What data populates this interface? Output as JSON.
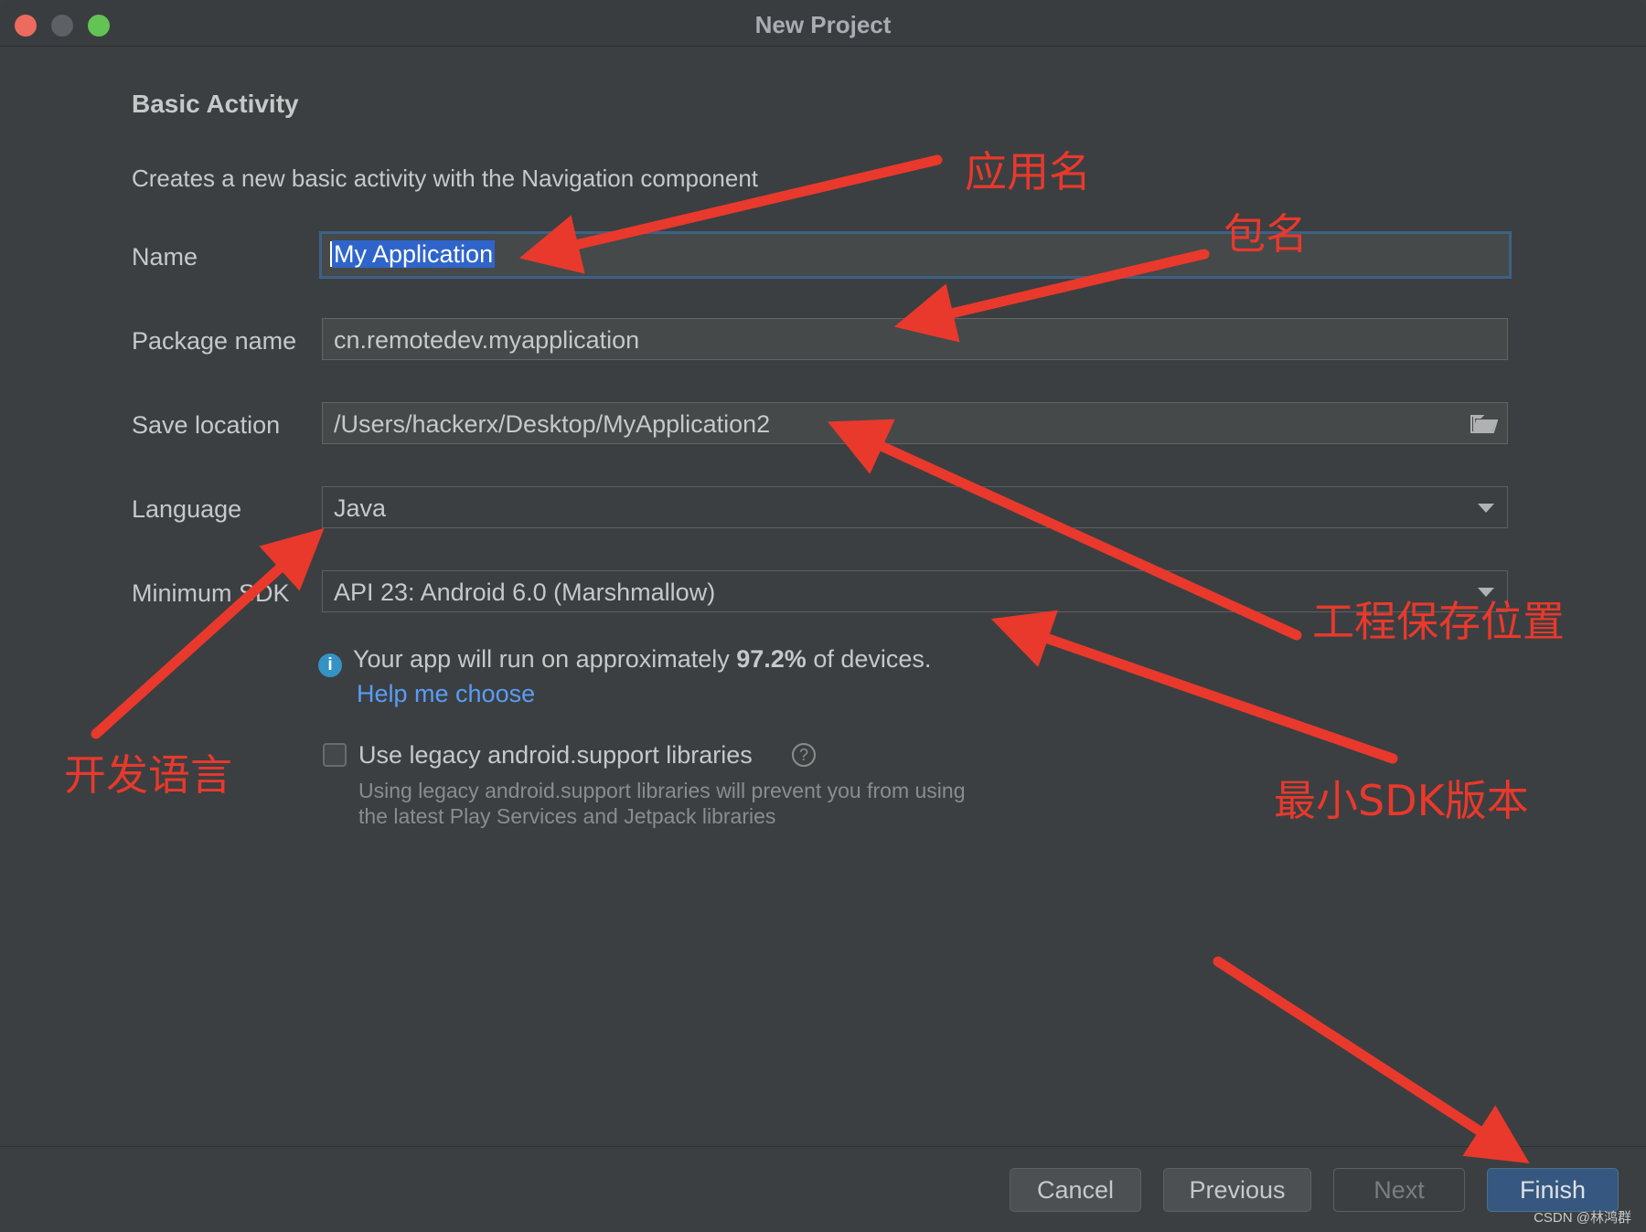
{
  "window": {
    "title": "New Project"
  },
  "heading": "Basic Activity",
  "description": "Creates a new basic activity with the Navigation component",
  "form": {
    "name_label": "Name",
    "name_value": "My Application",
    "package_label": "Package name",
    "package_value": "cn.remotedev.myapplication",
    "save_label": "Save location",
    "save_value": "/Users/hackerx/Desktop/MyApplication2",
    "language_label": "Language",
    "language_value": "Java",
    "sdk_label": "Minimum SDK",
    "sdk_value": "API 23: Android 6.0 (Marshmallow)"
  },
  "info": {
    "prefix": "Your app will run on approximately ",
    "percent": "97.2%",
    "suffix": " of devices.",
    "link": "Help me choose"
  },
  "legacy": {
    "label": "Use legacy android.support libraries",
    "hint_line1": "Using legacy android.support libraries will prevent you from using",
    "hint_line2": "the latest Play Services and Jetpack libraries",
    "checked": false
  },
  "buttons": {
    "cancel": "Cancel",
    "previous": "Previous",
    "next": "Next",
    "finish": "Finish"
  },
  "annotations": {
    "app_name": "应用名",
    "package_name": "包名",
    "save_location": "工程保存位置",
    "language": "开发语言",
    "min_sdk": "最小SDK版本"
  },
  "watermark": "CSDN @林鸿群",
  "colors": {
    "annotation": "#e8392c",
    "link": "#589df6",
    "primary_button": "#365880",
    "selection": "#2f65ca"
  }
}
